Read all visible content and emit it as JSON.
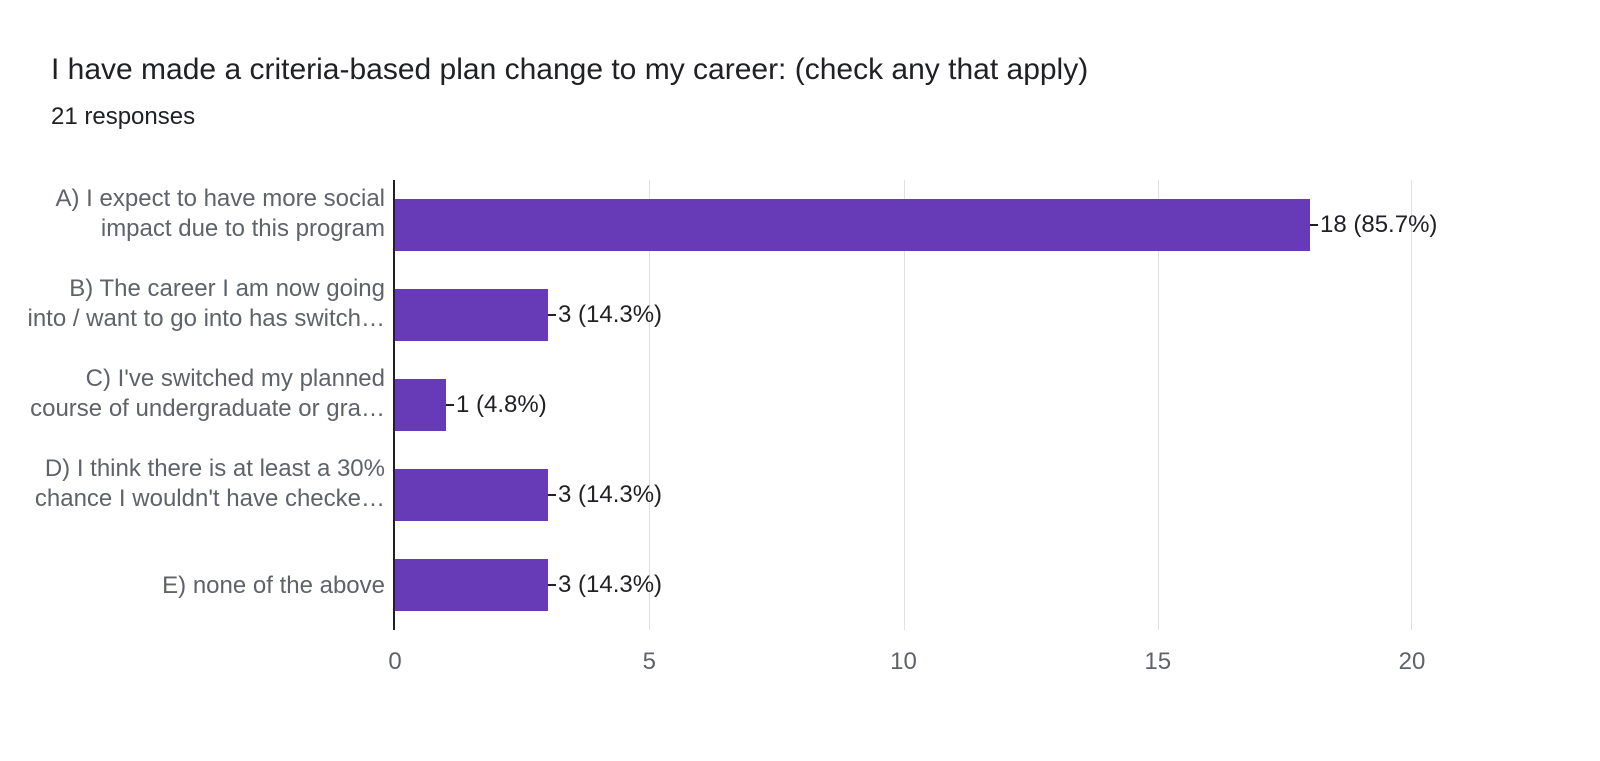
{
  "chart_data": {
    "type": "bar",
    "orientation": "horizontal",
    "title": "I have made a criteria-based plan change to my career: (check any that apply)",
    "responses_label": "21 responses",
    "total_responses": 21,
    "xlabel": "",
    "ylabel": "",
    "xlim": [
      0,
      20
    ],
    "x_ticks": [
      0,
      5,
      10,
      15,
      20
    ],
    "categories_full": [
      "A) I expect to have more social impact due to this program",
      "B) The career I am now going into / want to go into has switch…",
      "C) I've switched my planned course of undergraduate or gra…",
      "D) I think there is at least a 30% chance I wouldn't have checke…",
      "E) none of the above"
    ],
    "cat_line1": [
      "A) I expect to have more social",
      "B) The career I am now going",
      "C) I've switched my planned",
      "D) I think there is at least a 30%",
      "E) none of the above"
    ],
    "cat_line2": [
      "impact due to this program",
      "into / want to go into has switch…",
      "course of undergraduate or gra…",
      "chance I wouldn't have checke…",
      ""
    ],
    "values": [
      18,
      3,
      1,
      3,
      3
    ],
    "percentages": [
      85.7,
      14.3,
      4.8,
      14.3,
      14.3
    ],
    "value_labels": [
      "18 (85.7%)",
      "3 (14.3%)",
      "1 (4.8%)",
      "3 (14.3%)",
      "3 (14.3%)"
    ],
    "bar_color": "#673ab7"
  },
  "ticks": {
    "t0": "0",
    "t5": "5",
    "t10": "10",
    "t15": "15",
    "t20": "20"
  }
}
